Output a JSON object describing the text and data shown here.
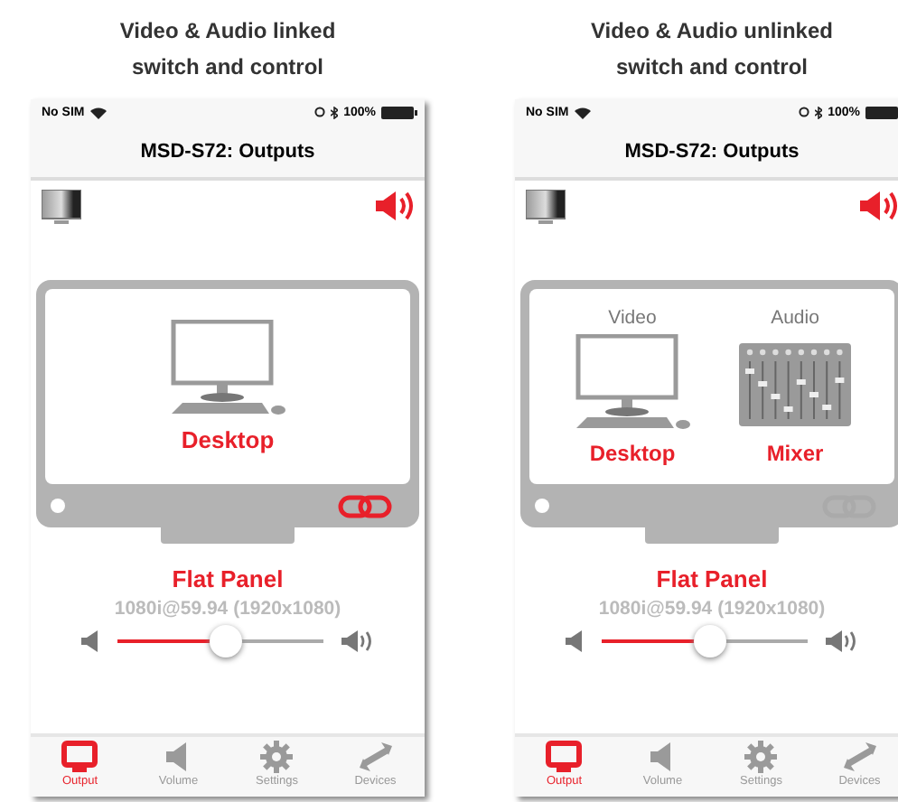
{
  "panels": [
    {
      "caption": "Video & Audio linked switch and control",
      "status": {
        "carrier": "No SIM",
        "battery": "100%"
      },
      "title": "MSD-S72: Outputs",
      "sources": [
        {
          "kind": "desktop",
          "name": "Desktop"
        }
      ],
      "linked": true,
      "output_name": "Flat Panel",
      "resolution": "1080i@59.94 (1920x1080)",
      "volume": {
        "level": 0.53
      },
      "tabs": [
        {
          "label": "Output",
          "kind": "output",
          "selected": true
        },
        {
          "label": "Volume",
          "kind": "volume",
          "selected": false
        },
        {
          "label": "Settings",
          "kind": "settings",
          "selected": false
        },
        {
          "label": "Devices",
          "kind": "devices",
          "selected": false
        }
      ]
    },
    {
      "caption": "Video & Audio unlinked switch and control",
      "status": {
        "carrier": "No SIM",
        "battery": "100%"
      },
      "title": "MSD-S72: Outputs",
      "sources": [
        {
          "kind": "desktop",
          "heading": "Video",
          "name": "Desktop"
        },
        {
          "kind": "mixer",
          "heading": "Audio",
          "name": "Mixer"
        }
      ],
      "linked": false,
      "output_name": "Flat Panel",
      "resolution": "1080i@59.94 (1920x1080)",
      "volume": {
        "level": 0.53
      },
      "tabs": [
        {
          "label": "Output",
          "kind": "output",
          "selected": true
        },
        {
          "label": "Volume",
          "kind": "volume",
          "selected": false
        },
        {
          "label": "Settings",
          "kind": "settings",
          "selected": false
        },
        {
          "label": "Devices",
          "kind": "devices",
          "selected": false
        }
      ]
    }
  ]
}
